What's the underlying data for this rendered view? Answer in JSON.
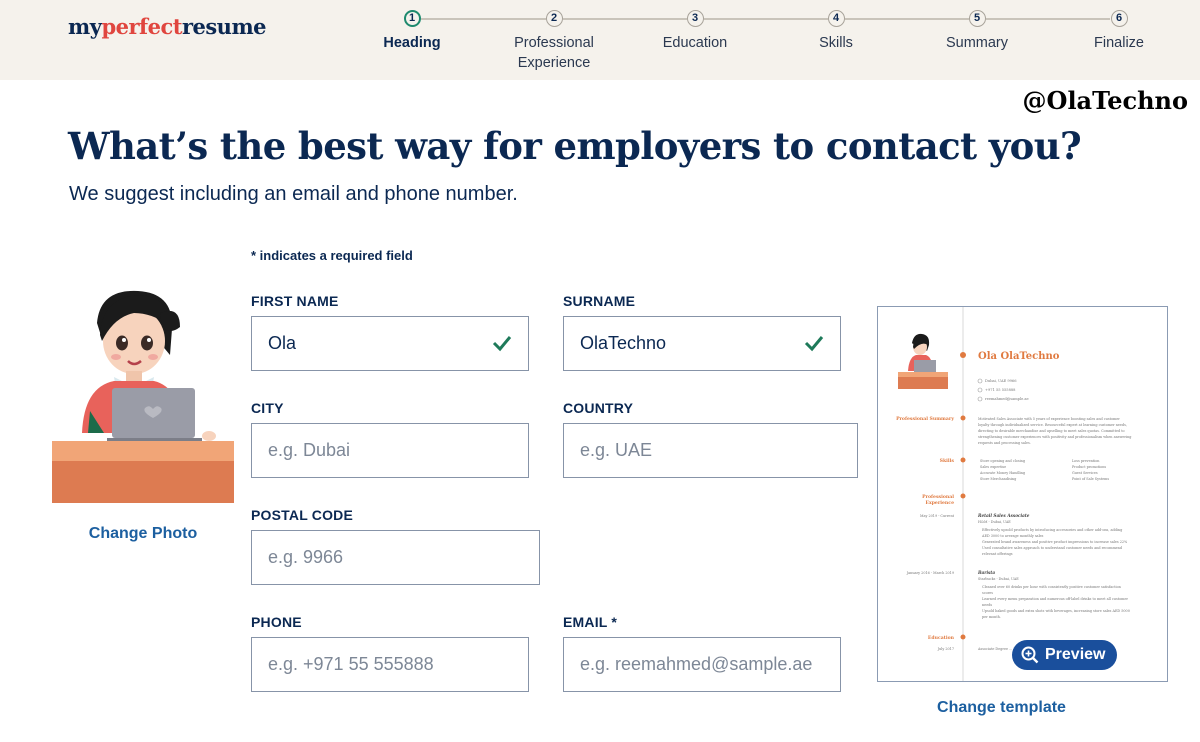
{
  "brand": {
    "logo_part1": "my",
    "logo_part2": "perfect",
    "logo_part3": "resume"
  },
  "steps": [
    {
      "num": "1",
      "label": "Heading",
      "active": true
    },
    {
      "num": "2",
      "label": "Professional Experience",
      "active": false
    },
    {
      "num": "3",
      "label": "Education",
      "active": false
    },
    {
      "num": "4",
      "label": "Skills",
      "active": false
    },
    {
      "num": "5",
      "label": "Summary",
      "active": false
    },
    {
      "num": "6",
      "label": "Finalize",
      "active": false
    }
  ],
  "watermark": "@OlaTechno",
  "page": {
    "title": "What’s the best way for employers to contact you?",
    "subtitle": "We suggest including an email and phone number.",
    "required_note": "* indicates a required field",
    "change_photo": "Change Photo"
  },
  "form": {
    "first_name": {
      "label": "FIRST NAME",
      "value": "Ola",
      "placeholder": ""
    },
    "surname": {
      "label": "SURNAME",
      "value": "OlaTechno",
      "placeholder": ""
    },
    "city": {
      "label": "CITY",
      "value": "",
      "placeholder": "e.g. Dubai"
    },
    "country": {
      "label": "COUNTRY",
      "value": "",
      "placeholder": "e.g. UAE"
    },
    "postal_code": {
      "label": "POSTAL CODE",
      "value": "",
      "placeholder": "e.g. 9966"
    },
    "phone": {
      "label": "PHONE",
      "value": "",
      "placeholder": "e.g. +971 55 555888"
    },
    "email": {
      "label": "EMAIL *",
      "value": "",
      "placeholder": "e.g. reemahmed@sample.ae"
    }
  },
  "preview": {
    "name": "Ola OlaTechno",
    "button": "Preview",
    "change_template": "Change template",
    "contact": [
      "Dubai, UAE 9966",
      "+971 55 555888",
      "reemahmed@sample.ae"
    ],
    "sections": {
      "summary": "Professional Summary",
      "skills": "Skills",
      "experience_1": "Professional",
      "experience_2": "Experience",
      "education": "Education"
    },
    "summary_lines": [
      "Motivated Sales Associate with 5 years of experience boosting sales and customer",
      "loyalty through individualized service. Resourceful expert at learning customer needs,",
      "directing to desirable merchandise and upselling to meet sales quotas. Committed to",
      "strengthening customer experiences with positivity and professionalism when answering",
      "requests and processing sales."
    ],
    "skills_left": [
      "Store opening and closing",
      "Sales expertise",
      "Accurate Money Handling",
      "Store Merchandising"
    ],
    "skills_right": [
      "Loss prevention",
      "Product promotions",
      "Guest Services",
      "Point of Sale Systems"
    ],
    "jobs": [
      {
        "dates": "May 2019 - Current",
        "title": "Retail Sales Associate",
        "company": "H&M - Dubai, UAE",
        "bullets": [
          "Effectively upsold products by introducing accessories and other add-ons, adding",
          "AED 3000 to average monthly sales",
          "Generated brand awareness and positive product impressions to increase sales 22%",
          "Used consultative sales approach to understand customer needs and recommend",
          "relevant offerings"
        ]
      },
      {
        "dates": "January 2016 - March 2019",
        "title": "Barista",
        "company": "Starbucks - Dubai, UAE",
        "bullets": [
          "Cleaned over 60 drinks per hour with consistently positive customer satisfaction",
          "scores",
          "Learned every menu preparation and numerous off-label drinks to meet all customer",
          "needs",
          "Upsold baked goods and extra shots with beverages, increasing store sales AED 5000",
          "per month."
        ]
      }
    ],
    "education": {
      "date": "July 2017",
      "line": "Associate Degree ... Dubai, UAE"
    }
  },
  "colors": {
    "navy": "#0b2852",
    "link": "#1c5fa0",
    "check_green": "#1e7a5a",
    "preview_button": "#1a4f9c",
    "accent_orange": "#e07a40",
    "logo_red": "#e0463f"
  }
}
